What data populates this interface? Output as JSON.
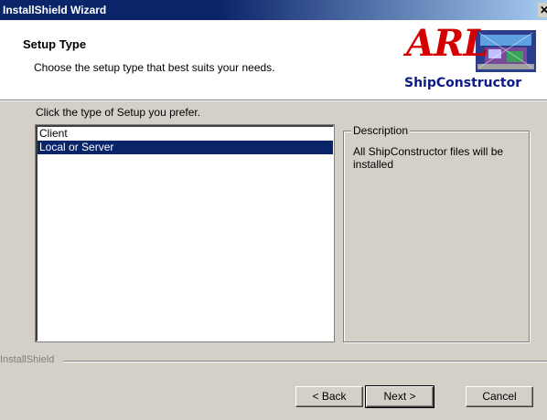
{
  "window": {
    "title": "InstallShield Wizard",
    "close_glyph": "✕"
  },
  "header": {
    "title": "Setup Type",
    "subtitle": "Choose the setup type that best suits your needs.",
    "logo": {
      "brand": "ARL",
      "product": "ShipConstructor"
    }
  },
  "main": {
    "instruction": "Click the type of Setup you prefer.",
    "setup_types": [
      {
        "label": "Client",
        "selected": false
      },
      {
        "label": "Local or Server",
        "selected": true
      }
    ],
    "description": {
      "legend": "Description",
      "text": "All ShipConstructor files will be installed"
    }
  },
  "footer": {
    "brand": "InstallShield",
    "back_label": "< Back",
    "next_label": "Next >",
    "cancel_label": "Cancel"
  },
  "colors": {
    "selection": "#0a246a",
    "brand_red": "#d40000",
    "brand_blue": "#0a1a8a"
  }
}
